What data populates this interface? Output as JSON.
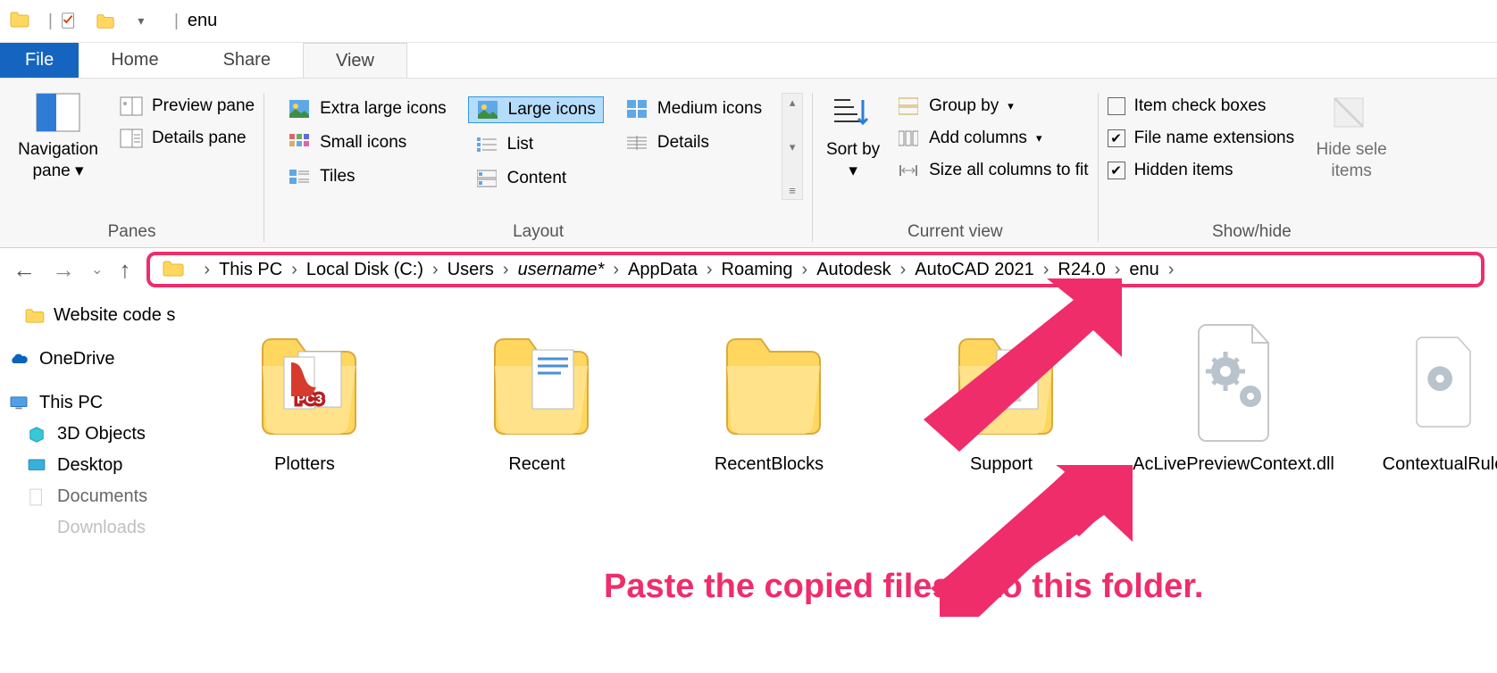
{
  "titlebar": {
    "window_title": "enu"
  },
  "tabs": {
    "file": "File",
    "home": "Home",
    "share": "Share",
    "view": "View"
  },
  "ribbon": {
    "panes": {
      "nav": "Navigation pane",
      "preview": "Preview pane",
      "details": "Details pane",
      "label": "Panes"
    },
    "layout": {
      "xlarge": "Extra large icons",
      "large": "Large icons",
      "medium": "Medium icons",
      "small": "Small icons",
      "list": "List",
      "details": "Details",
      "tiles": "Tiles",
      "content": "Content",
      "label": "Layout"
    },
    "current": {
      "sort": "Sort by",
      "group": "Group by",
      "addcols": "Add columns",
      "sizecols": "Size all columns to fit",
      "label": "Current view"
    },
    "show": {
      "itemck": "Item check boxes",
      "ext": "File name extensions",
      "hidden": "Hidden items",
      "hidebtn": "Hide sele\nitems",
      "label": "Show/hide"
    }
  },
  "breadcrumb": {
    "segs": [
      "This PC",
      "Local Disk (C:)",
      "Users",
      "username*",
      "AppData",
      "Roaming",
      "Autodesk",
      "AutoCAD 2021",
      "R24.0",
      "enu"
    ]
  },
  "tree": {
    "n0": "Website code stuff",
    "n1": "OneDrive",
    "n2": "This PC",
    "n3": "3D Objects",
    "n4": "Desktop",
    "n5": "Documents",
    "n6": "Downloads"
  },
  "items": {
    "i0": "Plotters",
    "i1": "Recent",
    "i2": "RecentBlocks",
    "i3": "Support",
    "i4": "AcLivePreviewContext.dll",
    "i5": "ContextualRule"
  },
  "annotation": "Paste the copied files into this folder."
}
